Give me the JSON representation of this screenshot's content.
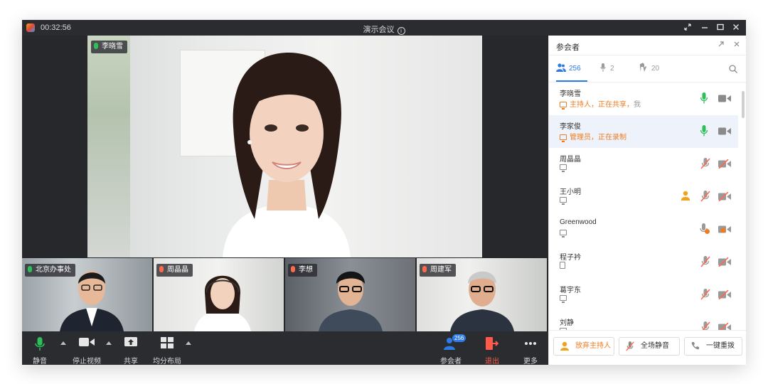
{
  "titlebar": {
    "time": "00:32:56",
    "meeting_title": "演示会议",
    "info_glyph": "i",
    "buttons": [
      "restore-icon",
      "minimize-icon",
      "maximize-icon",
      "close-icon"
    ]
  },
  "main_video": {
    "speaker": "李晓雪"
  },
  "thumbnails": [
    {
      "name": "北京办事处",
      "mic": "on"
    },
    {
      "name": "周晶晶",
      "mic": "off"
    },
    {
      "name": "李想",
      "mic": "off"
    },
    {
      "name": "周建军",
      "mic": "off"
    }
  ],
  "toolbar": {
    "mute": "静音",
    "stop_video": "停止视频",
    "share": "共享",
    "layout": "均分布局",
    "participants": "参会者",
    "participants_badge": "256",
    "leave": "退出",
    "more": "更多"
  },
  "panel": {
    "title": "参会者",
    "tabs": {
      "all": "256",
      "speaking": "2",
      "raised": "20"
    },
    "rows": [
      {
        "name": "李晓雪",
        "status": "主持人，正在共享，",
        "self": "我",
        "mic": "on",
        "cam": "on"
      },
      {
        "name": "李家俊",
        "status": "管理员，正在录制",
        "self": "",
        "mic": "on",
        "cam": "on"
      },
      {
        "name": "周晶晶",
        "status": "",
        "self": "",
        "mic": "off",
        "cam": "off"
      },
      {
        "name": "王小明",
        "status": "",
        "self": "",
        "mic": "off",
        "cam": "off",
        "host_req": true
      },
      {
        "name": "Greenwood",
        "status": "",
        "self": "",
        "mic": "req",
        "cam": "req"
      },
      {
        "name": "程子衿",
        "status": "",
        "self": "",
        "mic": "off",
        "cam": "off"
      },
      {
        "name": "葛宇东",
        "status": "",
        "self": "",
        "mic": "off",
        "cam": "off"
      },
      {
        "name": "刘静",
        "status": "",
        "self": "",
        "mic": "off",
        "cam": "off"
      }
    ],
    "footer": {
      "give_up_host": "放弃主持人",
      "mute_all": "全场静音",
      "redial": "一键重拨"
    }
  },
  "colors": {
    "accent": "#2d7be5",
    "orange": "#f27b1f",
    "mic_green": "#2fbf5a",
    "muted_red": "#ff6a4f"
  }
}
